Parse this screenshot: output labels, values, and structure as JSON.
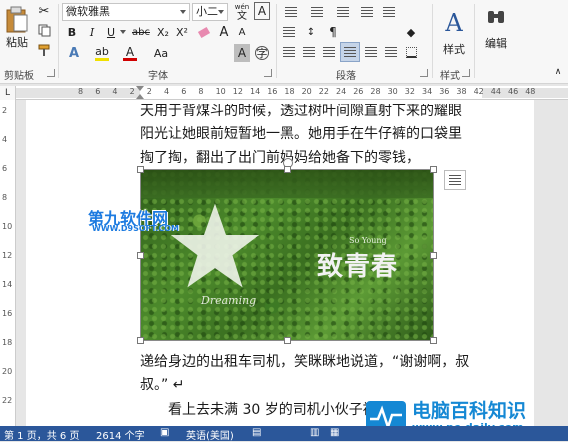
{
  "clipboard": {
    "paste_label": "粘贴",
    "group_label": "剪贴板"
  },
  "font": {
    "name_value": "微软雅黑",
    "size_value": "小二",
    "bold": "B",
    "italic": "I",
    "underline": "U",
    "strike": "abc",
    "subscript": "X₂",
    "superscript": "X²",
    "font_color_letter": "A",
    "aa_label": "Aa",
    "clear_format": "A",
    "wen_label": "wén",
    "wen_char": "文",
    "border_char": "A",
    "grow": "A",
    "shrink": "A",
    "group_label": "字体"
  },
  "paragraph": {
    "group_label": "段落",
    "shade_char": "A"
  },
  "styles": {
    "label": "样式",
    "group_label": "样式",
    "icon_char": "A"
  },
  "editing": {
    "label": "编辑"
  },
  "ruler": {
    "corner": "L",
    "top_numbers": [
      "8",
      "6",
      "4",
      "2",
      "2",
      "4",
      "6",
      "8",
      "10",
      "12",
      "14",
      "16",
      "18",
      "20",
      "22",
      "24",
      "26",
      "28",
      "30",
      "32",
      "34",
      "36",
      "38",
      "42",
      "44",
      "46",
      "48"
    ],
    "left_numbers": [
      "2",
      "4",
      "6",
      "8",
      "10",
      "12",
      "14",
      "16",
      "18",
      "20",
      "22"
    ]
  },
  "document": {
    "lines": [
      "天用于背煤斗的时候，透过树叶间隙直射下来的耀眼",
      "阳光让她眼前短暂地一黑。她用手在牛仔裤的口袋里",
      "掏了掏，翻出了出门前妈妈给她备下的零钱，",
      "递给身边的出租车司机，笑眯眯地说道，“谢谢啊，叔",
      "叔。” ↵",
      "　　看上去未满 30 岁的司机小伙子被"
    ],
    "image_text": {
      "main": "致青春",
      "sub": "So Young",
      "signature": "Dreaming"
    }
  },
  "watermarks": {
    "site1_name": "第九软件网",
    "site1_url": "WWW.D9SOFT.COM",
    "site2_name": "电脑百科知识",
    "site2_url": "www.pc-daily.com"
  },
  "status": {
    "page": "第 1 页，共 6 页",
    "words": "2614 个字",
    "lang": "英语(美国)"
  },
  "colors": {
    "accent": "#2b579a",
    "brand_blue": "#1588d4",
    "highlight": "#f0e000",
    "font_red": "#d00000"
  }
}
